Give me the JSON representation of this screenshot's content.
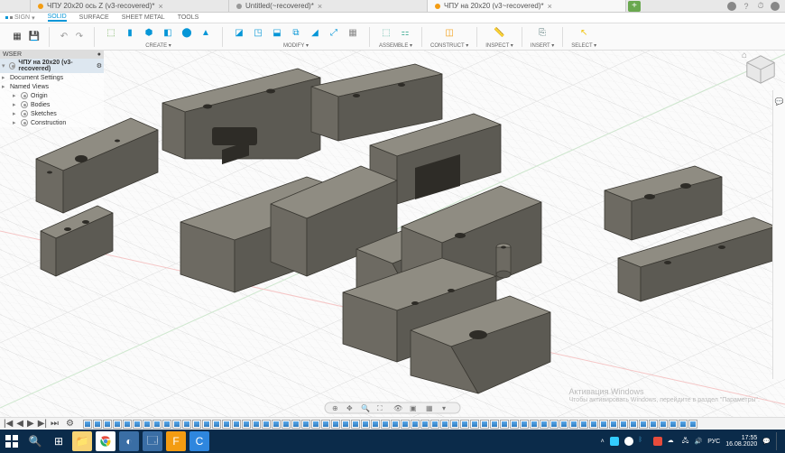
{
  "docTabs": [
    {
      "label": "ЧПУ 20x20 ось Z (v3-recovered)*",
      "active": false,
      "dot": "o"
    },
    {
      "label": "Untitled(~recovered)*",
      "active": false,
      "dot": "g"
    },
    {
      "label": "ЧПУ на 20x20 (v3~recovered)*",
      "active": true,
      "dot": "o"
    }
  ],
  "sign": "SIGN",
  "ribbonTabs": [
    {
      "label": "SOLID",
      "active": true
    },
    {
      "label": "SURFACE",
      "active": false
    },
    {
      "label": "SHEET METAL",
      "active": false
    },
    {
      "label": "TOOLS",
      "active": false
    }
  ],
  "toolGroups": {
    "create": "CREATE ▾",
    "modify": "MODIFY ▾",
    "assemble": "ASSEMBLE ▾",
    "construct": "CONSTRUCT ▾",
    "inspect": "INSPECT ▾",
    "insert": "INSERT ▾",
    "select": "SELECT ▾"
  },
  "browser": {
    "title": "WSER",
    "root": "ЧПУ на 20x20 (v3-recovered)",
    "items": [
      {
        "label": "Document Settings",
        "caret": "▸"
      },
      {
        "label": "Named Views",
        "caret": "▸"
      },
      {
        "label": "Origin",
        "caret": "▸",
        "sub": true
      },
      {
        "label": "Bodies",
        "caret": "▸",
        "sub": true
      },
      {
        "label": "Sketches",
        "caret": "▸",
        "sub": true
      },
      {
        "label": "Construction",
        "caret": "▸",
        "sub": true
      }
    ]
  },
  "watermark": {
    "l1": "Активация Windows",
    "l2": "Чтобы активировать Windows, перейдите в раздел \"Параметры\"."
  },
  "clock": {
    "time": "17:55",
    "date": "16.08.2020"
  },
  "lang": "РУС",
  "timelineCount": 62
}
